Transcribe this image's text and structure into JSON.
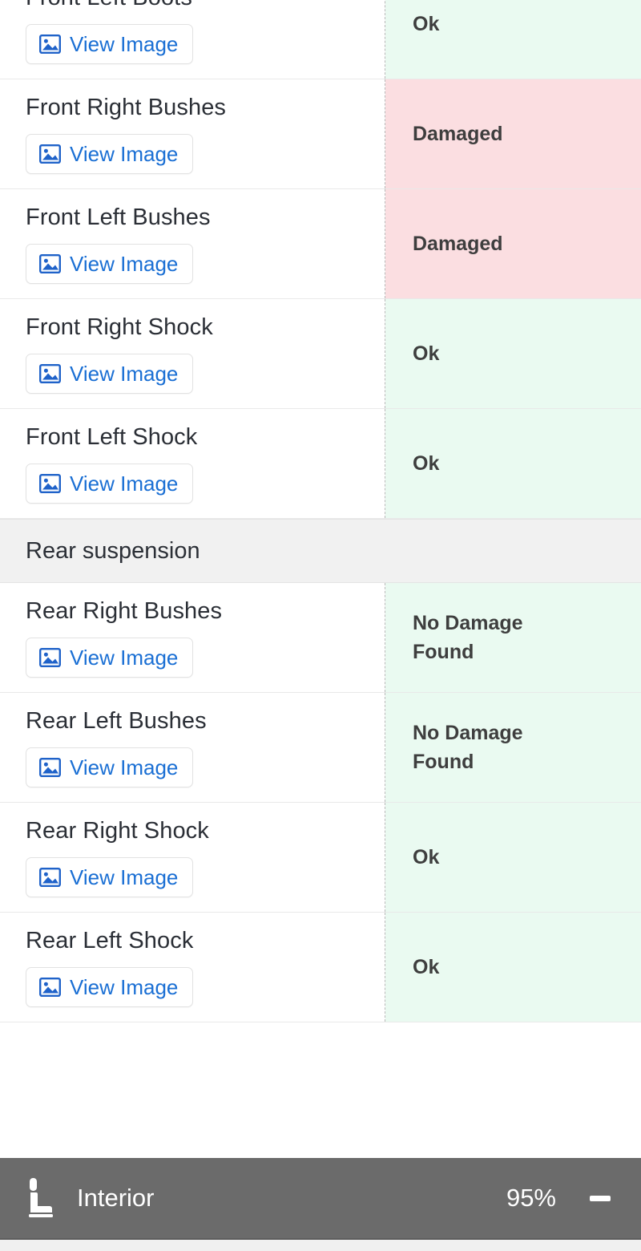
{
  "table": {
    "view_image_label": "View Image",
    "image_icon": "image-icon",
    "rows": [
      {
        "part": "Front Left Boots",
        "status": "Ok",
        "state": "ok"
      },
      {
        "part": "Front Right Bushes",
        "status": "Damaged",
        "state": "damaged"
      },
      {
        "part": "Front Left Bushes",
        "status": "Damaged",
        "state": "damaged"
      },
      {
        "part": "Front Right Shock",
        "status": "Ok",
        "state": "ok"
      },
      {
        "part": "Front Left Shock",
        "status": "Ok",
        "state": "ok"
      }
    ],
    "section": {
      "title": "Rear suspension"
    },
    "rows_after": [
      {
        "part": "Rear Right Bushes",
        "status": "No Damage Found",
        "state": "ok"
      },
      {
        "part": "Rear Left Bushes",
        "status": "No Damage Found",
        "state": "ok"
      },
      {
        "part": "Rear Right Shock",
        "status": "Ok",
        "state": "ok"
      },
      {
        "part": "Rear Left Shock",
        "status": "Ok",
        "state": "ok"
      }
    ]
  },
  "bottom_bar": {
    "icon": "car-seat-icon",
    "label": "Interior",
    "percent": "95%",
    "collapse_icon": "minus-icon"
  },
  "colors": {
    "ok_background": "#eafaf1",
    "damaged_background": "#fbdee1",
    "link": "#1a6fd4",
    "status_text": "#3e3e3e",
    "section_background": "#f1f1f1",
    "bottom_bar_background": "#6b6b6b"
  }
}
